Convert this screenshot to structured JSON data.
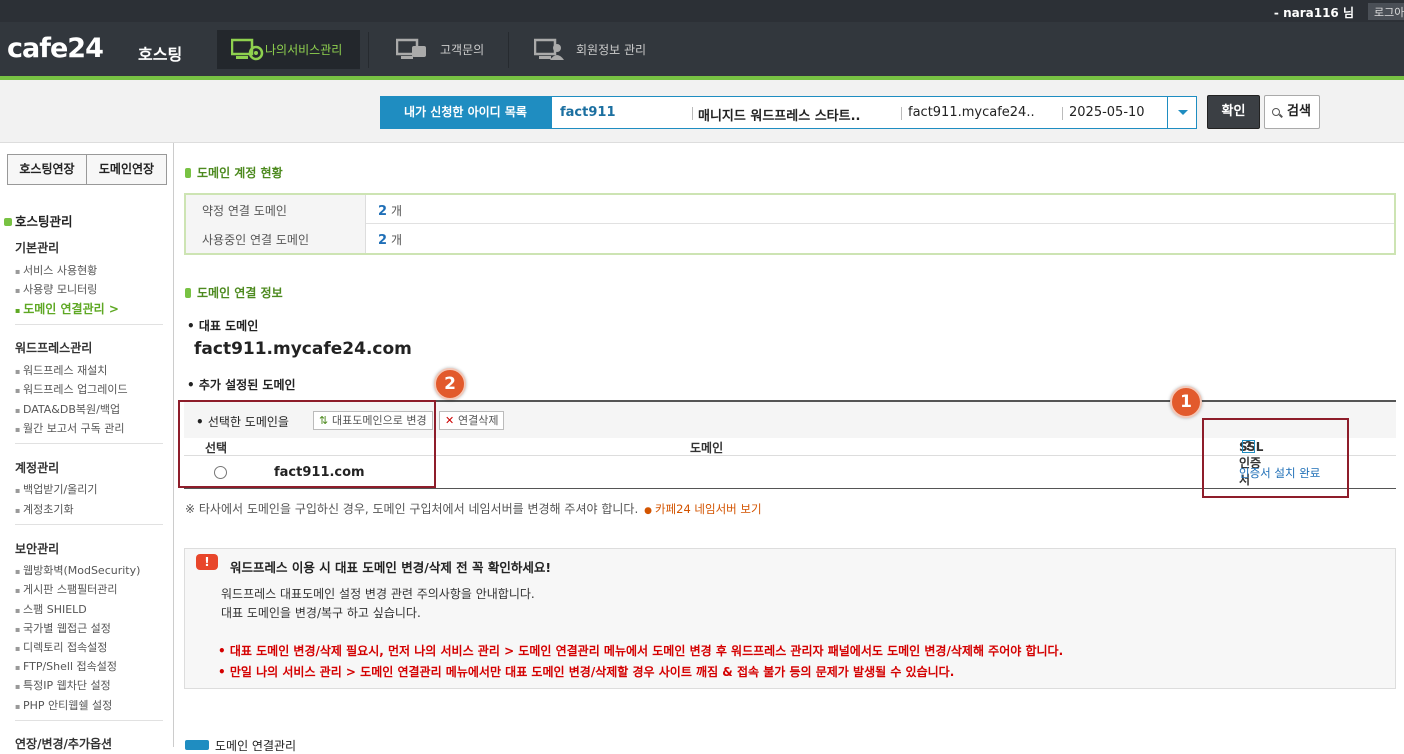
{
  "topbar": {
    "user": "- nara116 님",
    "logout": "로그아웃"
  },
  "header": {
    "logo": "cafe24",
    "logo_sub": "호스팅",
    "nav": [
      {
        "label": "나의서비스관리",
        "icon": "service-manage-icon"
      },
      {
        "label": "고객문의",
        "icon": "customer-inquiry-icon"
      },
      {
        "label": "회원정보 관리",
        "icon": "member-info-icon"
      }
    ]
  },
  "idbar": {
    "label": "내가 신청한 아이디 목록",
    "account_id": "fact911",
    "product": "매니지드 워드프레스 스타트..",
    "domain": "fact911.mycafe24..",
    "date": "2025-05-10",
    "confirm": "확인",
    "search": "검색"
  },
  "sidebar": {
    "btn_hosting": "호스팅연장",
    "btn_domain": "도메인연장",
    "title": "호스팅관리",
    "sections": [
      {
        "title": "기본관리",
        "items": [
          "서비스 사용현황",
          "사용량 모니터링",
          "도메인 연결관리 >"
        ]
      },
      {
        "title": "워드프레스관리",
        "items": [
          "워드프레스 재설치",
          "워드프레스 업그레이드",
          "DATA&DB복원/백업",
          "월간 보고서 구독 관리"
        ]
      },
      {
        "title": "계정관리",
        "items": [
          "백업받기/올리기",
          "계정초기화"
        ]
      },
      {
        "title": "보안관리",
        "items": [
          "웹방화벽(ModSecurity)",
          "게시판 스팸필터관리",
          "스팸 SHIELD",
          "국가별 웹접근 설정",
          "디렉토리 접속설정",
          "FTP/Shell 접속설정",
          "특정IP 웹차단 설정",
          "PHP 안티웹쉘 설정"
        ]
      },
      {
        "title": "연장/변경/추가옵션",
        "items": []
      }
    ]
  },
  "main": {
    "status_title": "도메인 계정 현황",
    "status_rows": [
      {
        "label": "약정 연결 도메인",
        "value": "2",
        "unit": "개"
      },
      {
        "label": "사용중인 연결 도메인",
        "value": "2",
        "unit": "개"
      }
    ],
    "info_title": "도메인 연결 정보",
    "rep_label": "대표 도메인",
    "rep_domain": "fact911.mycafe24.com",
    "added_label": "추가 설정된 도메인",
    "table": {
      "selected_label": "선택한 도메인을",
      "btn_set_rep": "대표도메인으로 변경",
      "btn_delete": "연결삭제",
      "col_select": "선택",
      "col_domain": "도메인",
      "col_ssl": "SSL 인증서",
      "help": "?",
      "rows": [
        {
          "domain": "fact911.com",
          "ssl": "인증서 설치 완료"
        }
      ]
    },
    "badges": [
      "1",
      "2"
    ],
    "note": "※ 타사에서 도메인을 구입하신 경우, 도메인 구입처에서 네임서버를 변경해 주셔야 합니다.",
    "note_link": "카페24 네임서버 보기",
    "warning": {
      "icon": "!",
      "title": "워드프레스 이용 시 대표 도메인 변경/삭제 전 꼭 확인하세요!",
      "line1": "워드프레스 대표도메인 설정 변경 관련 주의사항을 안내합니다.",
      "line2": "대표 도메인을 변경/복구 하고 싶습니다.",
      "red1": "대표 도메인 변경/삭제 필요시, 먼저 나의 서비스 관리 > 도메인 연결관리 메뉴에서 도메인 변경 후 워드프레스 관리자 패널에서도 도메인 변경/삭제해 주어야 합니다.",
      "red2": "만일 나의 서비스 관리 > 도메인 연결관리 메뉴에서만 대표 도메인 변경/삭제할 경우 사이트 깨짐 & 접속 불가 등의 문제가 발생될 수 있습니다."
    },
    "bottom_tip": "도메인 연결관리"
  },
  "colors": {
    "accent": "#78c243",
    "blue": "#1f8dc1",
    "red_box": "#8e1d2a",
    "badge": "#e25a2c",
    "warn_red": "#d40000"
  }
}
